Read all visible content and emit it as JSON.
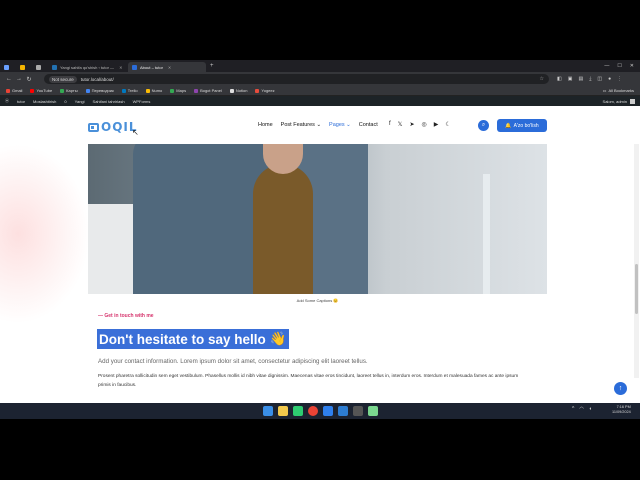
{
  "browser": {
    "tabs": [
      {
        "label": "",
        "active": false
      },
      {
        "label": "",
        "active": false
      },
      {
        "label": "",
        "active": false
      },
      {
        "label": "Yangi sahifa qo'shish ‹ tutor —",
        "active": false
      },
      {
        "label": "About – tutor",
        "active": true
      }
    ],
    "new_tab": "+",
    "security_chip": "Not secure",
    "url": "tutor.local/about/",
    "bookmarks": [
      "Gmail",
      "YouTube",
      "Карты",
      "Переводчик",
      "Trello",
      "Numo",
      "Maps",
      "Bogot Panel",
      "Notion",
      "Yogeez"
    ],
    "all_bookmarks": "All Bookmarks"
  },
  "wpadmin": {
    "items": [
      "tutor",
      "Moslashtirish",
      "0",
      "Yangi",
      "Sahifani tahrirlash",
      "WPForms"
    ],
    "greeting": "Salom, admin"
  },
  "site": {
    "logo_text": "OQIL",
    "menu": [
      "Home",
      "Post Features ⌄",
      "Pages ⌄",
      "Contact"
    ],
    "active_menu": "Pages ⌄",
    "cta_label": "A'zo bo'lish"
  },
  "content": {
    "image_caption": "Add Some Captions 😊",
    "get_in_touch": "— Get in touch with me",
    "headline": "Don't hesitate to say hello",
    "wave_emoji": "👋",
    "lead": "Add your contact information. Lorem ipsum dolor sit amet, consectetur adipiscing elit laoreet tellus.",
    "paragraph": "Prosent pharetra sollicitudin sem eget vestibulum. Phasellus mollis id nibh vitae dignissim. Maecenas vitae eros tincidunt, laoreet tellus in, interdum eros. Interdum et malesuada fames ac ante ipsum primis in faucibus."
  },
  "taskbar": {
    "time": "7:16 PM",
    "date": "11/09/2024"
  },
  "colors": {
    "accent": "#2b6cd9",
    "pink": "#d6336c",
    "wp_bar": "#1d2327"
  }
}
